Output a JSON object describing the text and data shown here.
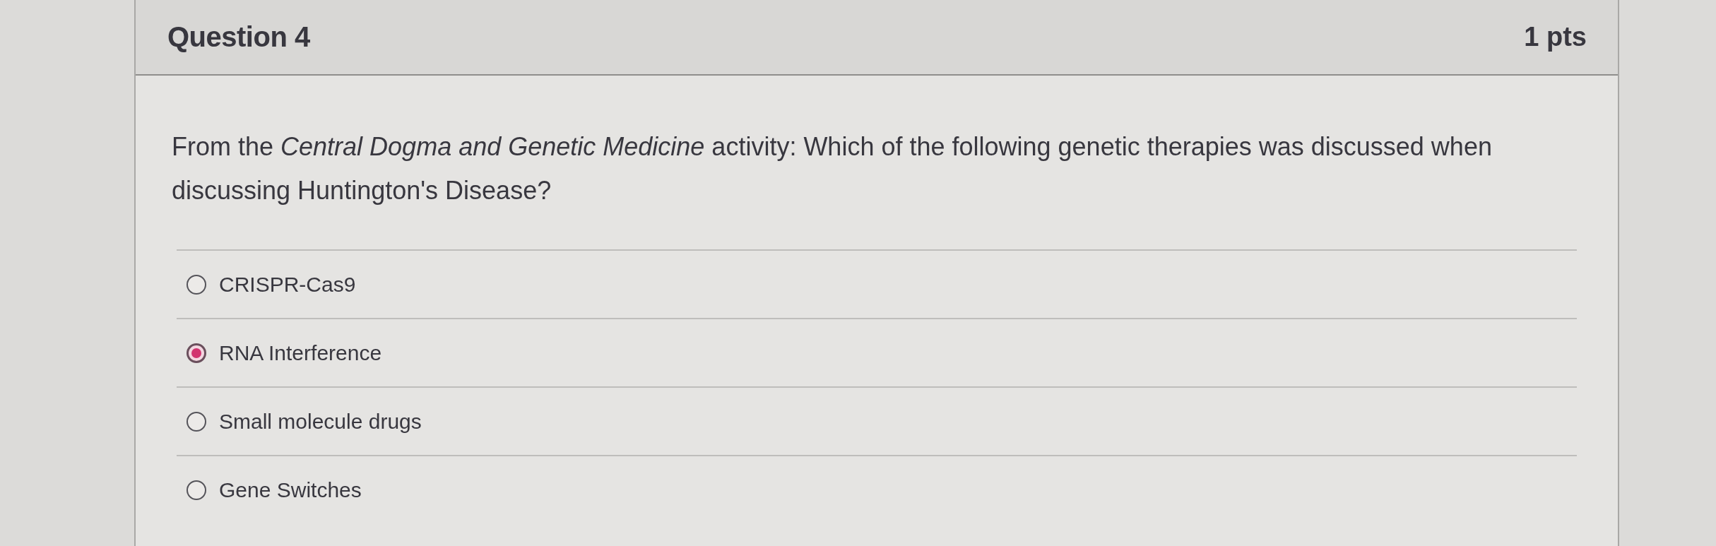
{
  "question": {
    "title": "Question 4",
    "points": "1 pts",
    "text": "From the *Central Dogma and Genetic Medicine* activity: Which of the following genetic therapies was discussed when discussing Huntington's Disease?"
  },
  "answers": [
    {
      "label": "CRISPR-Cas9",
      "selected": false
    },
    {
      "label": "RNA Interference",
      "selected": true
    },
    {
      "label": "Small molecule drugs",
      "selected": false
    },
    {
      "label": "Gene Switches",
      "selected": false
    }
  ]
}
